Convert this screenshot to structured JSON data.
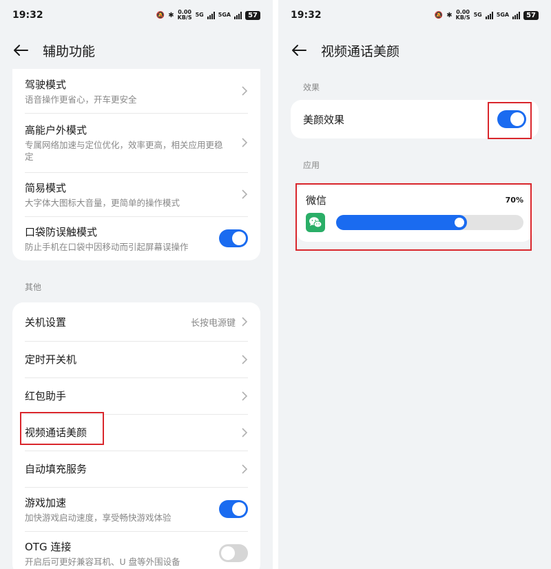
{
  "status": {
    "time": "19:32",
    "net_speed_top": "0.00",
    "net_speed_unit": "KB/S",
    "net_type": "5G",
    "sig_label": "5GA",
    "battery": "57"
  },
  "left": {
    "title": "辅助功能",
    "group1": [
      {
        "label": "驾驶模式",
        "sub": "语音操作更省心，开车更安全",
        "control": "chevron"
      },
      {
        "label": "高能户外模式",
        "sub": "专属网络加速与定位优化，效率更高，相关应用更稳定",
        "control": "chevron"
      },
      {
        "label": "简易模式",
        "sub": "大字体大图标大音量，更简单的操作模式",
        "control": "chevron"
      },
      {
        "label": "口袋防误触模式",
        "sub": "防止手机在口袋中因移动而引起屏幕误操作",
        "control": "toggle",
        "on": true
      }
    ],
    "other_label": "其他",
    "group2": [
      {
        "label": "关机设置",
        "value": "长按电源键",
        "control": "chevron"
      },
      {
        "label": "定时开关机",
        "control": "chevron"
      },
      {
        "label": "红包助手",
        "control": "chevron"
      },
      {
        "label": "视频通话美颜",
        "control": "chevron"
      },
      {
        "label": "自动填充服务",
        "control": "chevron"
      },
      {
        "label": "游戏加速",
        "sub": "加快游戏启动速度，享受畅快游戏体验",
        "control": "toggle",
        "on": true
      },
      {
        "label": "OTG 连接",
        "sub": "开启后可更好兼容耳机、U 盘等外围设备",
        "control": "toggle",
        "on": false
      }
    ]
  },
  "right": {
    "title": "视频通话美颜",
    "effect_section": "效果",
    "effect_label": "美颜效果",
    "effect_on": true,
    "apps_section": "应用",
    "app_name": "微信",
    "app_percent_label": "70%",
    "app_level": 0.7
  },
  "colors": {
    "accent": "#1a6bf0",
    "highlight": "#d9262c",
    "wechat": "#2aae67"
  }
}
